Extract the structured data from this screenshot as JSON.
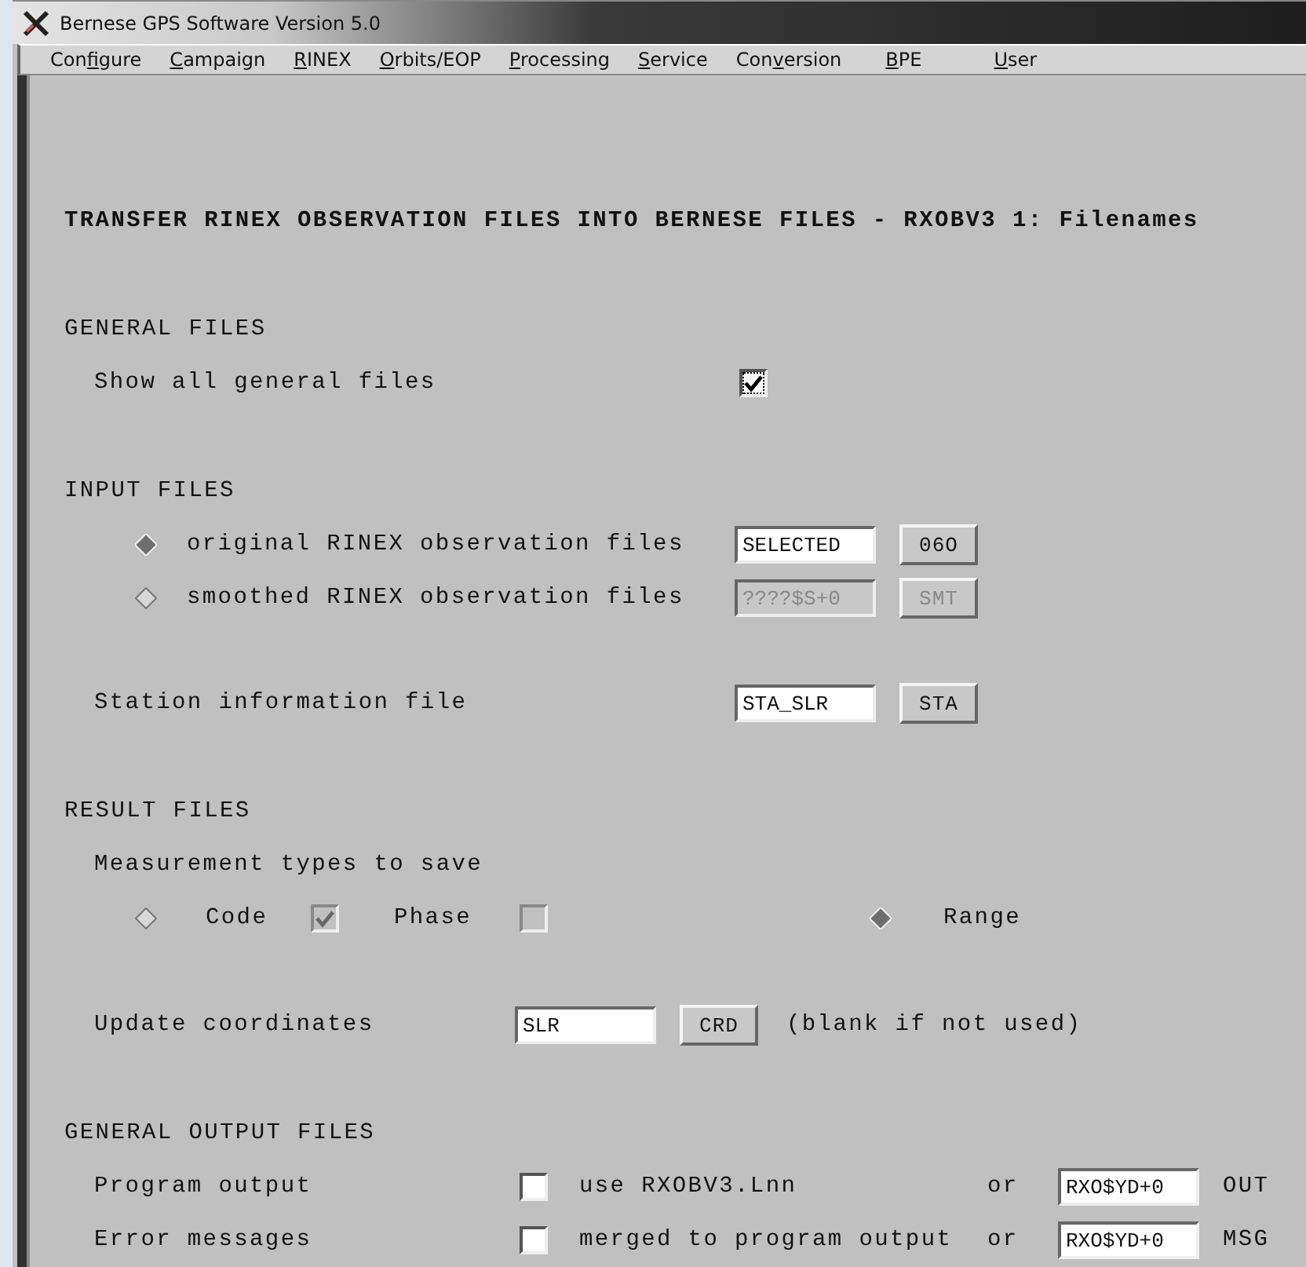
{
  "window": {
    "title": "Bernese GPS Software Version 5.0"
  },
  "menu": [
    {
      "before": "Con",
      "key": "f",
      "after": "igure"
    },
    {
      "key": "C",
      "after": "ampaign"
    },
    {
      "key": "R",
      "after": "INEX"
    },
    {
      "key": "O",
      "after": "rbits/EOP"
    },
    {
      "key": "P",
      "after": "rocessing"
    },
    {
      "key": "S",
      "after": "ervice"
    },
    {
      "before": "Con",
      "key": "v",
      "after": "ersion"
    },
    {
      "key": "B",
      "after": "PE"
    },
    {
      "key": "U",
      "after": "ser"
    }
  ],
  "form": {
    "heading": "TRANSFER RINEX OBSERVATION FILES INTO BERNESE FILES - RXOBV3 1: Filenames",
    "sections": [
      {
        "title": "GENERAL FILES",
        "rows": [
          {
            "kind": "checkbox",
            "label": "Show all general files",
            "checked": true
          }
        ]
      },
      {
        "title": "INPUT FILES",
        "rows": [
          {
            "kind": "radio_file",
            "label": "original RINEX observation files",
            "selected": true,
            "value": "SELECTED",
            "button": "06O",
            "disabled": false
          },
          {
            "kind": "radio_file",
            "label": "smoothed RINEX observation files",
            "selected": false,
            "value": "????$S+0",
            "button": "SMT",
            "disabled": true
          },
          {
            "kind": "file",
            "label": "Station information file",
            "value": "STA_SLR",
            "button": "STA"
          }
        ]
      },
      {
        "title": "RESULT FILES",
        "rows": [
          {
            "kind": "label",
            "label": "Measurement types to save"
          },
          {
            "kind": "options",
            "items": [
              {
                "kind": "radio",
                "selected": false
              },
              {
                "kind": "text",
                "text": "Code"
              },
              {
                "kind": "checkbox",
                "checked": true,
                "disabled": true
              },
              {
                "kind": "text",
                "text": "Phase"
              },
              {
                "kind": "checkbox",
                "checked": false,
                "disabled": true
              },
              {
                "kind": "radio",
                "selected": true
              },
              {
                "kind": "text",
                "text": "Range"
              }
            ]
          },
          {
            "kind": "file_hint",
            "label": "Update coordinates",
            "value": "SLR",
            "button": "CRD",
            "hint": "(blank if not used)"
          }
        ]
      },
      {
        "title": "GENERAL OUTPUT FILES",
        "rows": [
          {
            "kind": "output",
            "label": "Program output",
            "checked": false,
            "option": "use RXOBV3.Lnn",
            "or": "or",
            "value": "RXO$YD+0",
            "extension": "OUT"
          },
          {
            "kind": "output",
            "label": "Error messages",
            "checked": false,
            "option": "merged to program output",
            "or": "or",
            "value": "RXO$YD+0",
            "extension": "MSG"
          }
        ]
      }
    ]
  }
}
